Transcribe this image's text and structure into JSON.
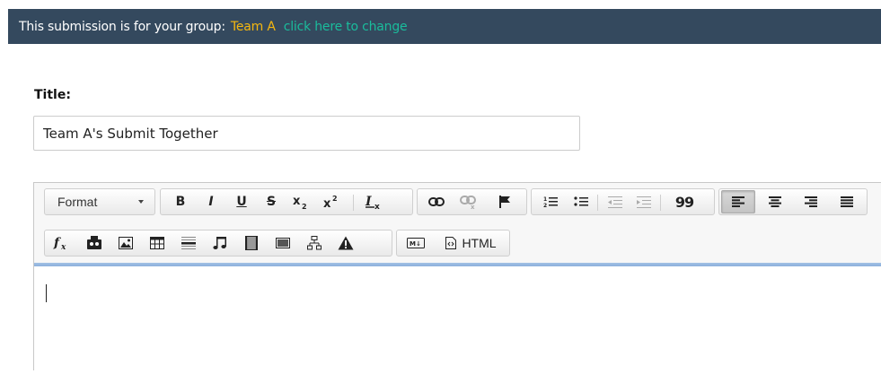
{
  "banner": {
    "prefix": "This submission is for your group:",
    "group_name": "Team A",
    "change_link": "click here to change",
    "bg_color": "#34495e",
    "group_color": "#f5b70f",
    "link_color": "#1abc9c"
  },
  "title_field": {
    "label": "Title:",
    "value": "Team A's Submit Together"
  },
  "toolbar": {
    "format_label": "Format",
    "bold": "B",
    "italic": "I",
    "underline": "U",
    "strike": "S",
    "blockquote": "99",
    "html_label": "HTML"
  },
  "editor": {
    "divider_color": "#8cb0dc"
  }
}
